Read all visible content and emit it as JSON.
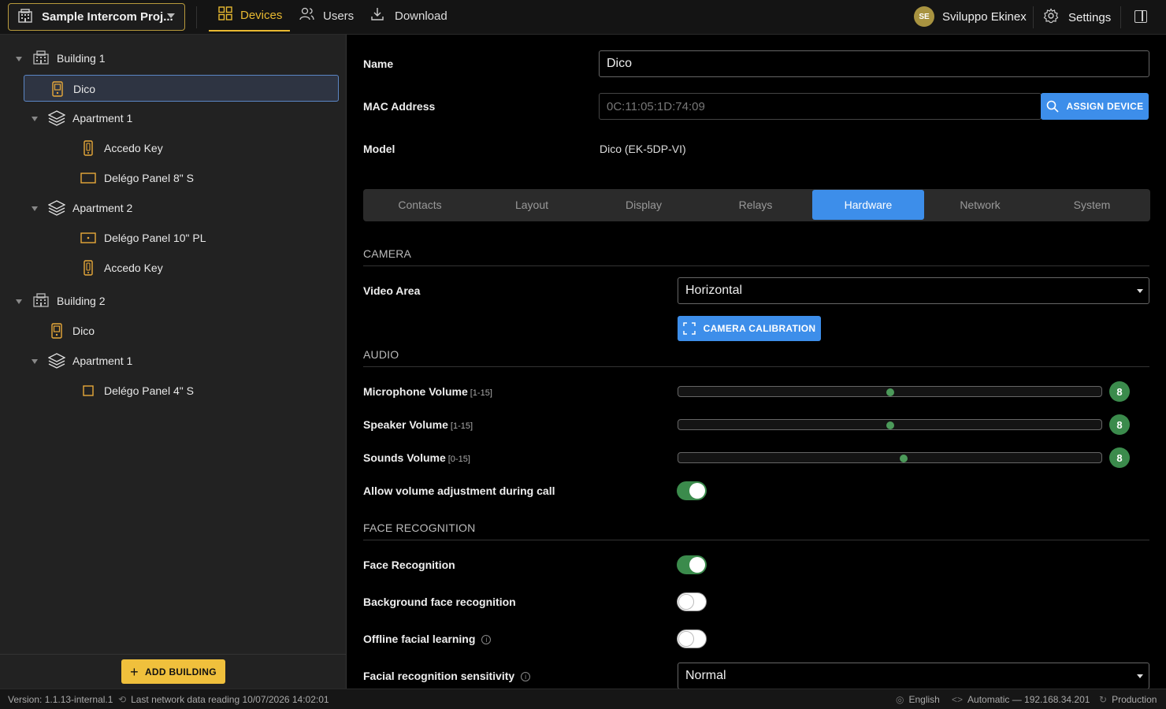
{
  "header": {
    "project_name": "Sample Intercom Proj...",
    "nav": [
      {
        "label": "Devices",
        "icon": "grid-icon",
        "active": true
      },
      {
        "label": "Users",
        "icon": "users-icon",
        "active": false
      },
      {
        "label": "Download",
        "icon": "download-icon",
        "active": false
      }
    ],
    "user_initials": "SE",
    "user_name": "Sviluppo Ekinex",
    "settings_label": "Settings"
  },
  "tree": [
    {
      "label": "Building 1",
      "type": "building",
      "level": 0,
      "expanded": true
    },
    {
      "label": "Dico",
      "type": "dico",
      "level": 1,
      "selected": true
    },
    {
      "label": "Apartment 1",
      "type": "apartment",
      "level": 1,
      "expanded": true
    },
    {
      "label": "Accedo Key",
      "type": "key",
      "level": 2
    },
    {
      "label": "Delégo Panel 8\" S",
      "type": "panel",
      "level": 2
    },
    {
      "label": "Apartment 2",
      "type": "apartment",
      "level": 1,
      "expanded": true
    },
    {
      "label": "Delégo Panel 10\" PL",
      "type": "panel-pl",
      "level": 2
    },
    {
      "label": "Accedo Key",
      "type": "key",
      "level": 2
    },
    {
      "label": "Building 2",
      "type": "building",
      "level": 0,
      "expanded": true
    },
    {
      "label": "Dico",
      "type": "dico",
      "level": 1
    },
    {
      "label": "Apartment 1",
      "type": "apartment",
      "level": 1,
      "expanded": true
    },
    {
      "label": "Delégo Panel 4\" S",
      "type": "panel-small",
      "level": 2
    }
  ],
  "sidebar_footer": {
    "add_building_label": "ADD BUILDING"
  },
  "device": {
    "name_label": "Name",
    "name_value": "Dico",
    "mac_label": "MAC Address",
    "mac_value": "0C:11:05:1D:74:09",
    "assign_label": "ASSIGN DEVICE",
    "model_label": "Model",
    "model_value": "Dico (EK-5DP-VI)"
  },
  "tabs": [
    {
      "label": "Contacts",
      "active": false
    },
    {
      "label": "Layout",
      "active": false
    },
    {
      "label": "Display",
      "active": false
    },
    {
      "label": "Relays",
      "active": false
    },
    {
      "label": "Hardware",
      "active": true
    },
    {
      "label": "Network",
      "active": false
    },
    {
      "label": "System",
      "active": false
    }
  ],
  "camera": {
    "title": "CAMERA",
    "video_area_label": "Video Area",
    "video_area_value": "Horizontal",
    "calibration_label": "CAMERA CALIBRATION"
  },
  "audio": {
    "title": "AUDIO",
    "sliders": [
      {
        "label": "Microphone Volume",
        "range": "[1-15]",
        "value": 8,
        "min": 1,
        "max": 15,
        "display": "8"
      },
      {
        "label": "Speaker Volume",
        "range": "[1-15]",
        "value": 8,
        "min": 1,
        "max": 15,
        "display": "8"
      },
      {
        "label": "Sounds Volume",
        "range": "[0-15]",
        "value": 8,
        "min": 0,
        "max": 15,
        "display": "8"
      }
    ],
    "allow_adjust_label": "Allow volume adjustment during call",
    "allow_adjust_on": true
  },
  "face": {
    "title": "FACE RECOGNITION",
    "items": [
      {
        "label": "Face Recognition",
        "on": true,
        "info": false
      },
      {
        "label": "Background face recognition",
        "on": false,
        "info": false
      },
      {
        "label": "Offline facial learning",
        "on": false,
        "info": true
      }
    ],
    "sensitivity_label": "Facial recognition sensitivity",
    "sensitivity_value": "Normal"
  },
  "status": {
    "version": "Version: 1.1.13-internal.1",
    "last_reading": "Last network data reading 10/07/2026 14:02:01",
    "language": "English",
    "network": "Automatic — 192.168.34.201",
    "environment": "Production"
  },
  "colors": {
    "accent": "#e8b931",
    "primary": "#3d8eea",
    "success": "#3b8b4c"
  }
}
